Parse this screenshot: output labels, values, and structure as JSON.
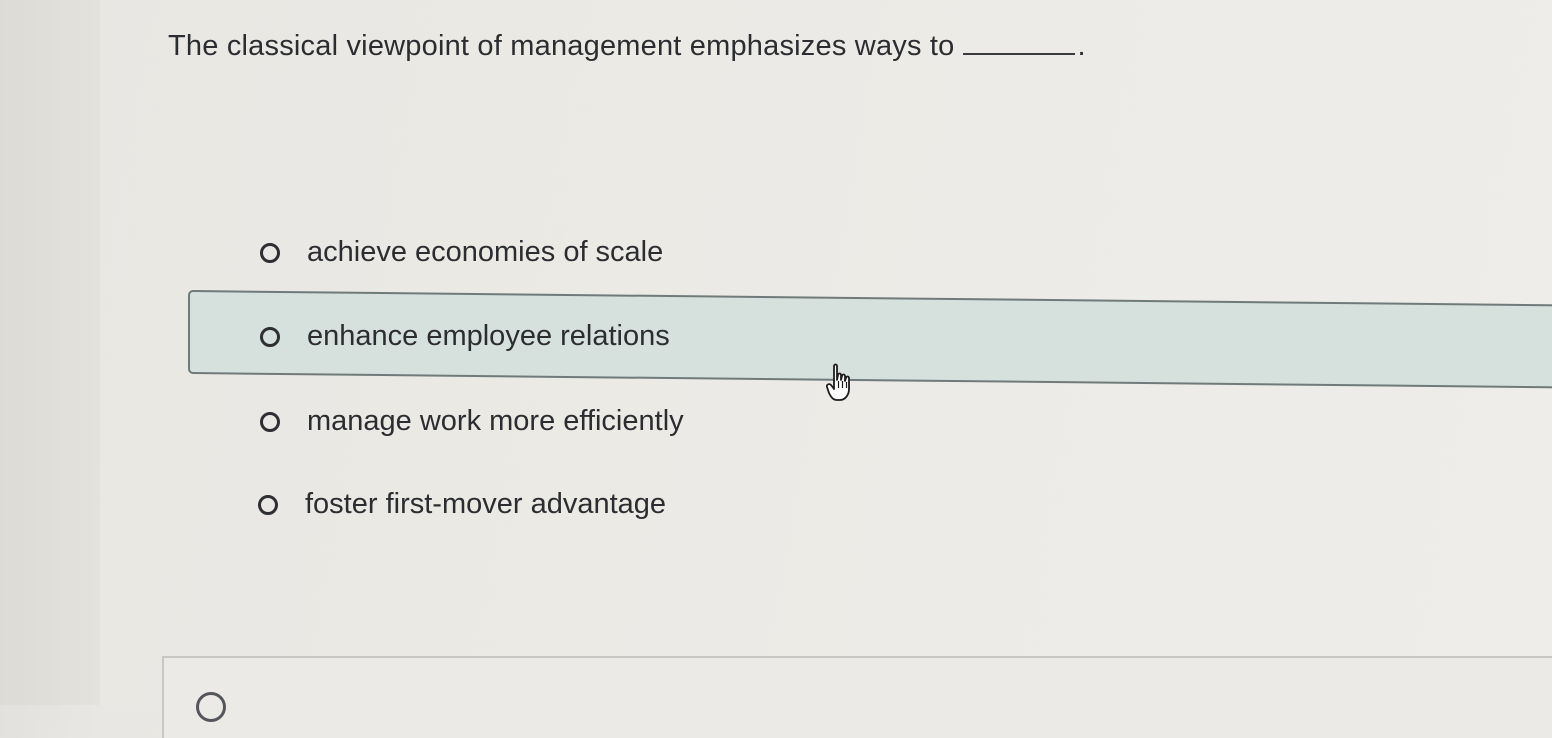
{
  "question": {
    "text": "The classical viewpoint of management emphasizes ways to",
    "period": "."
  },
  "options": [
    {
      "label": "achieve economies of scale",
      "selected": false
    },
    {
      "label": "enhance employee relations",
      "selected": false,
      "hovered": true
    },
    {
      "label": "manage work more efficiently",
      "selected": false
    },
    {
      "label": "foster first-mover advantage",
      "selected": false
    }
  ],
  "colors": {
    "text": "#2c2d31",
    "hover_fill": "#d6e0dc",
    "hover_border": "#6f7a7a"
  },
  "icons": {
    "cursor": "hand-pointer-icon",
    "radio": "radio-unchecked-icon"
  }
}
